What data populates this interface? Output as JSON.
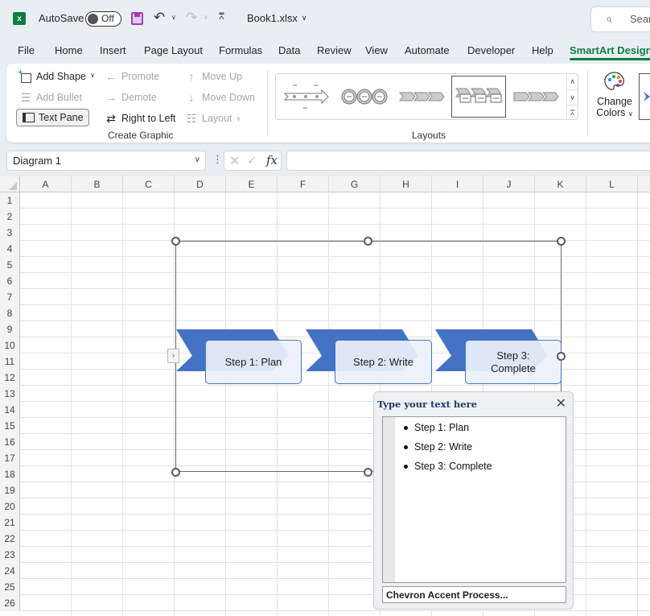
{
  "titlebar": {
    "autosave_label": "AutoSave",
    "autosave_state": "Off",
    "file_name": "Book1.xlsx",
    "search_placeholder": "Search"
  },
  "menu_tabs": [
    {
      "label": "File"
    },
    {
      "label": "Home"
    },
    {
      "label": "Insert"
    },
    {
      "label": "Page Layout"
    },
    {
      "label": "Formulas"
    },
    {
      "label": "Data"
    },
    {
      "label": "Review"
    },
    {
      "label": "View"
    },
    {
      "label": "Automate"
    },
    {
      "label": "Developer"
    },
    {
      "label": "Help"
    },
    {
      "label": "SmartArt Design",
      "active": true
    }
  ],
  "ribbon": {
    "create_graphic": {
      "add_shape": "Add Shape",
      "add_bullet": "Add Bullet",
      "text_pane": "Text Pane",
      "promote": "Promote",
      "demote": "Demote",
      "right_to_left": "Right to Left",
      "move_up": "Move Up",
      "move_down": "Move Down",
      "layout": "Layout",
      "group_label": "Create Graphic"
    },
    "layouts": {
      "group_label": "Layouts",
      "items": [
        "Basic Timeline",
        "Circle Process",
        "Basic Chevron Process",
        "Chevron Accent Process",
        "Closed Chevron Process"
      ],
      "selected_index": 3
    },
    "change_colors": {
      "line1": "Change",
      "line2": "Colors"
    }
  },
  "formula_bar": {
    "name_box": "Diagram 1",
    "fx_label": "fx",
    "formula": ""
  },
  "grid": {
    "columns": [
      "A",
      "B",
      "C",
      "D",
      "E",
      "F",
      "G",
      "H",
      "I",
      "J",
      "K",
      "L"
    ],
    "rows": [
      "1",
      "2",
      "3",
      "4",
      "5",
      "6",
      "7",
      "8",
      "9",
      "10",
      "11",
      "12",
      "13",
      "14",
      "15",
      "16",
      "17",
      "18",
      "19",
      "20",
      "21",
      "22",
      "23",
      "24",
      "25",
      "26"
    ]
  },
  "smartart": {
    "accent_color": "#4472c4",
    "steps": [
      {
        "text": "Step 1: Plan"
      },
      {
        "text": "Step 2: Write"
      },
      {
        "text": "Step 3: Complete"
      }
    ]
  },
  "text_pane": {
    "title": "Type your text here",
    "items": [
      "Step 1: Plan",
      "Step 2: Write",
      "Step 3: Complete"
    ],
    "footer": "Chevron Accent Process..."
  }
}
